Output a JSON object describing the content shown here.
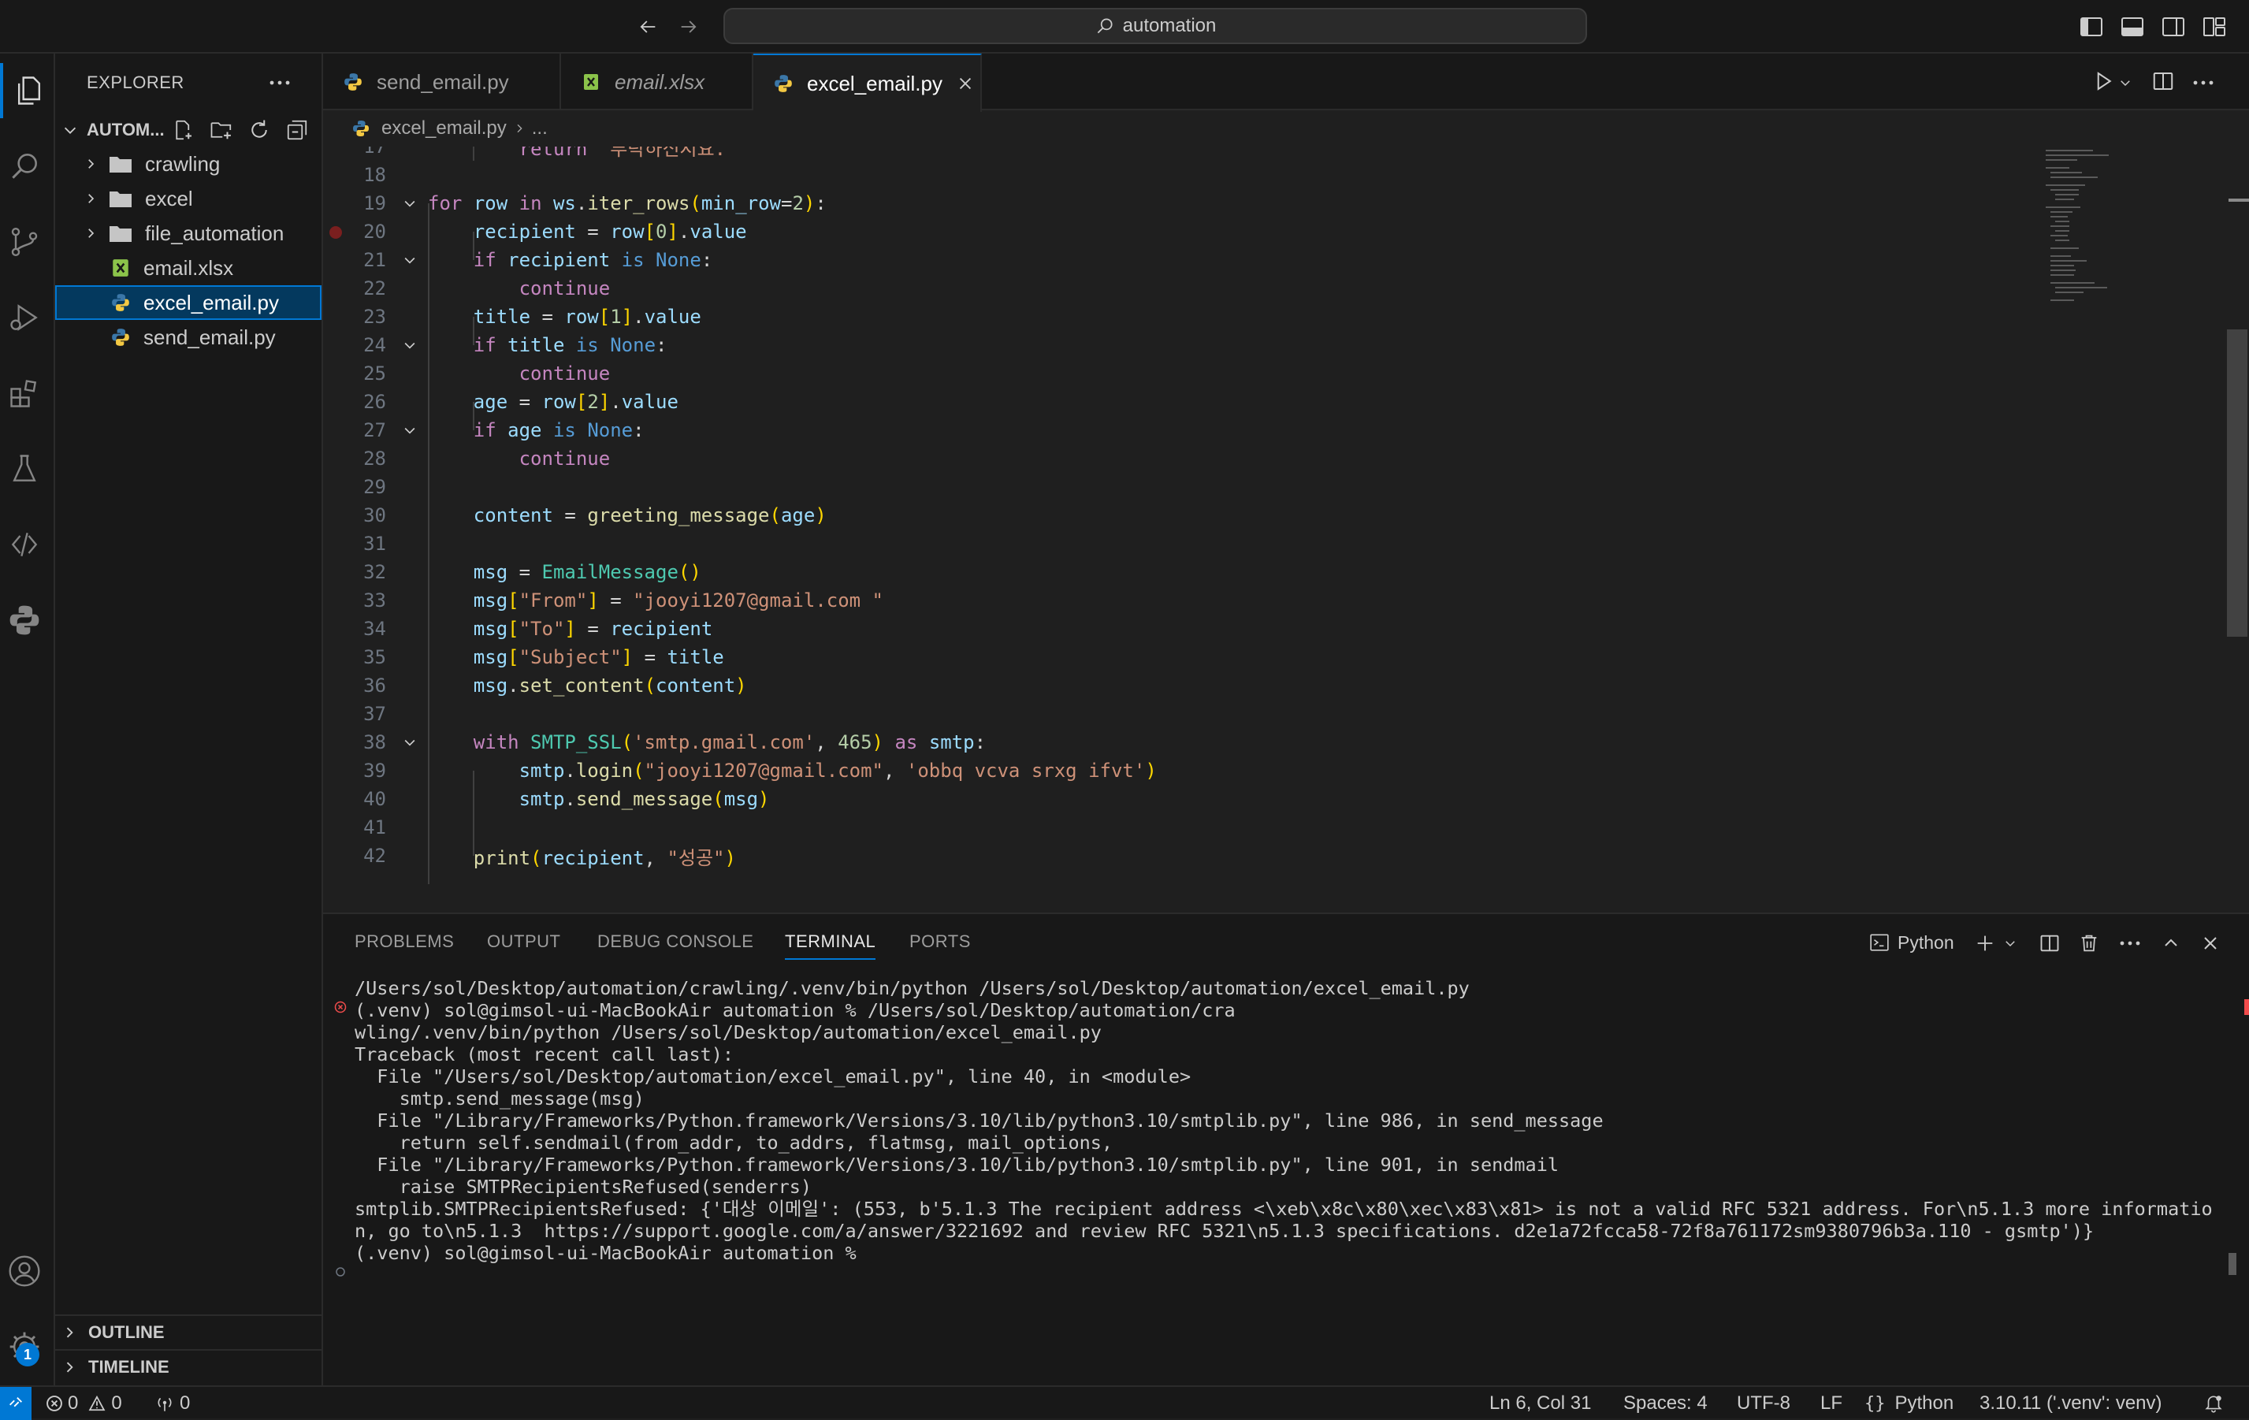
{
  "titlebar": {
    "search_text": "automation"
  },
  "sidebar": {
    "title": "EXPLORER",
    "folder_name": "AUTOM...",
    "items": [
      {
        "label": "crawling",
        "type": "folder"
      },
      {
        "label": "excel",
        "type": "folder"
      },
      {
        "label": "file_automation",
        "type": "folder"
      },
      {
        "label": "email.xlsx",
        "type": "excel"
      },
      {
        "label": "excel_email.py",
        "type": "python",
        "selected": true
      },
      {
        "label": "send_email.py",
        "type": "python"
      }
    ],
    "outline_label": "OUTLINE",
    "timeline_label": "TIMELINE",
    "accounts_badge": "1"
  },
  "tabs": [
    {
      "label": "send_email.py"
    },
    {
      "label": "email.xlsx"
    },
    {
      "label": "excel_email.py",
      "active": true
    }
  ],
  "breadcrumb": {
    "file": "excel_email.py",
    "rest": "..."
  },
  "code": {
    "lines": [
      {
        "n": "17",
        "text": "        return \"부탁하신시요.\""
      },
      {
        "n": "18",
        "text": ""
      },
      {
        "n": "19",
        "text": "for row in ws.iter_rows(min_row=2):"
      },
      {
        "n": "20",
        "text": "    recipient = row[0].value"
      },
      {
        "n": "21",
        "text": "    if recipient is None:"
      },
      {
        "n": "22",
        "text": "        continue"
      },
      {
        "n": "23",
        "text": "    title = row[1].value"
      },
      {
        "n": "24",
        "text": "    if title is None:"
      },
      {
        "n": "25",
        "text": "        continue"
      },
      {
        "n": "26",
        "text": "    age = row[2].value"
      },
      {
        "n": "27",
        "text": "    if age is None:"
      },
      {
        "n": "28",
        "text": "        continue"
      },
      {
        "n": "29",
        "text": ""
      },
      {
        "n": "30",
        "text": "    content = greeting_message(age)"
      },
      {
        "n": "31",
        "text": ""
      },
      {
        "n": "32",
        "text": "    msg = EmailMessage()"
      },
      {
        "n": "33",
        "text": "    msg[\"From\"] = \"jooyi1207@gmail.com \""
      },
      {
        "n": "34",
        "text": "    msg[\"To\"] = recipient"
      },
      {
        "n": "35",
        "text": "    msg[\"Subject\"] = title"
      },
      {
        "n": "36",
        "text": "    msg.set_content(content)"
      },
      {
        "n": "37",
        "text": ""
      },
      {
        "n": "38",
        "text": "    with SMTP_SSL('smtp.gmail.com', 465) as smtp:"
      },
      {
        "n": "39",
        "text": "        smtp.login(\"jooyi1207@gmail.com\", 'obbq vcva srxg ifvt')"
      },
      {
        "n": "40",
        "text": "        smtp.send_message(msg)"
      },
      {
        "n": "41",
        "text": ""
      },
      {
        "n": "42",
        "text": "    print(recipient, \"성공\")"
      }
    ]
  },
  "panel": {
    "tabs": [
      "PROBLEMS",
      "OUTPUT",
      "DEBUG CONSOLE",
      "TERMINAL",
      "PORTS"
    ],
    "active_tab": "TERMINAL",
    "terminal_name": "Python",
    "terminal_lines": [
      "/Users/sol/Desktop/automation/crawling/.venv/bin/python /Users/sol/Desktop/automation/excel_email.py",
      "(.venv) sol@gimsol-ui-MacBookAir automation % /Users/sol/Desktop/automation/cra",
      "wling/.venv/bin/python /Users/sol/Desktop/automation/excel_email.py",
      "Traceback (most recent call last):",
      "  File \"/Users/sol/Desktop/automation/excel_email.py\", line 40, in <module>",
      "    smtp.send_message(msg)",
      "  File \"/Library/Frameworks/Python.framework/Versions/3.10/lib/python3.10/smtplib.py\", line 986, in send_message",
      "    return self.sendmail(from_addr, to_addrs, flatmsg, mail_options,",
      "  File \"/Library/Frameworks/Python.framework/Versions/3.10/lib/python3.10/smtplib.py\", line 901, in sendmail",
      "    raise SMTPRecipientsRefused(senderrs)",
      "smtplib.SMTPRecipientsRefused: {'대상 이메일': (553, b'5.1.3 The recipient address <\\xeb\\x8c\\x80\\xec\\x83\\x81> is not a valid RFC 5321 address. For\\n5.1.3 more informatio",
      "n, go to\\n5.1.3  https://support.google.com/a/answer/3221692 and review RFC 5321\\n5.1.3 specifications. d2e1a72fcca58-72f8a761172sm9380796b3a.110 - gsmtp')}",
      "(.venv) sol@gimsol-ui-MacBookAir automation % "
    ]
  },
  "status": {
    "errors": "0",
    "warnings": "0",
    "ports": "0",
    "cursor": "Ln 6, Col 31",
    "spaces": "Spaces: 4",
    "encoding": "UTF-8",
    "eol": "LF",
    "language": "Python",
    "interpreter": "3.10.11 ('.venv': venv)"
  },
  "colors": {
    "accent": "#0078d4",
    "selection": "#04395e",
    "error": "#f14c4c"
  }
}
